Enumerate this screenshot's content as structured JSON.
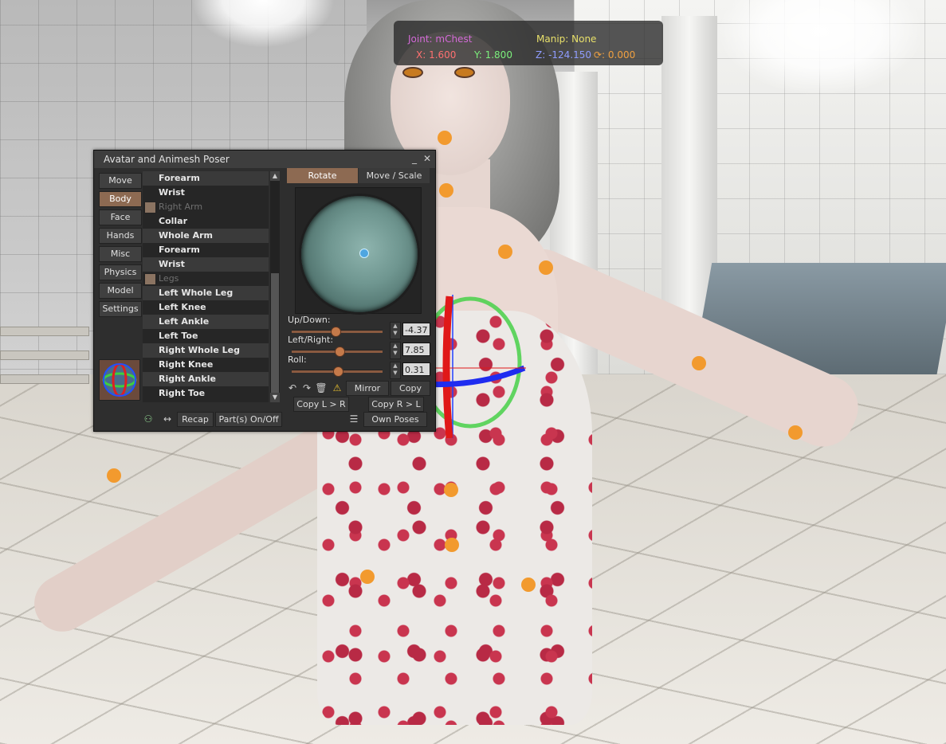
{
  "hud": {
    "joint": "Joint: mChest",
    "manip": "Manip: None",
    "x": "X: 1.600",
    "y": "Y: 1.800",
    "z": "Z: -124.150",
    "rot": "⟳: 0.000"
  },
  "window": {
    "title": "Avatar and Animesh Poser",
    "minimize": "_",
    "close": "✕"
  },
  "left_tabs": [
    "Move",
    "Body",
    "Face",
    "Hands",
    "Misc",
    "Physics",
    "Model",
    "Settings"
  ],
  "selected_left_tab": "Body",
  "joint_list": [
    {
      "label": "Forearm",
      "style": "alt"
    },
    {
      "label": "Wrist",
      "style": ""
    },
    {
      "label": "Right Arm",
      "style": "dim",
      "icon": true
    },
    {
      "label": "Collar",
      "style": ""
    },
    {
      "label": "Whole Arm",
      "style": "alt"
    },
    {
      "label": "Forearm",
      "style": ""
    },
    {
      "label": "Wrist",
      "style": "alt"
    },
    {
      "label": "Legs",
      "style": "dim",
      "icon": true
    },
    {
      "label": "Left Whole Leg",
      "style": "alt"
    },
    {
      "label": "Left Knee",
      "style": ""
    },
    {
      "label": "Left Ankle",
      "style": "alt"
    },
    {
      "label": "Left Toe",
      "style": ""
    },
    {
      "label": "Right Whole Leg",
      "style": "alt"
    },
    {
      "label": "Right Knee",
      "style": ""
    },
    {
      "label": "Right Ankle",
      "style": "alt"
    },
    {
      "label": "Right Toe",
      "style": ""
    }
  ],
  "sub_tabs": {
    "rotate": "Rotate",
    "move_scale": "Move / Scale"
  },
  "sliders": {
    "up_down": {
      "label": "Up/Down:",
      "value": "-4.37",
      "level": 0.48
    },
    "left_right": {
      "label": "Left/Right:",
      "value": "7.85",
      "level": 0.52
    },
    "roll": {
      "label": "Roll:",
      "value": "0.31",
      "level": 0.5
    }
  },
  "buttons": {
    "mirror": "Mirror",
    "copy": "Copy",
    "copy_l_r": "Copy L > R",
    "copy_r_l": "Copy R > L",
    "recap": "Recap",
    "parts": "Part(s) On/Off",
    "own_poses": "Own Poses"
  },
  "colors": {
    "accent": "#8d6a52",
    "joint_dot": "#f29a2e",
    "hud_joint": "#d46ad8",
    "hud_manip": "#e8e06a"
  }
}
